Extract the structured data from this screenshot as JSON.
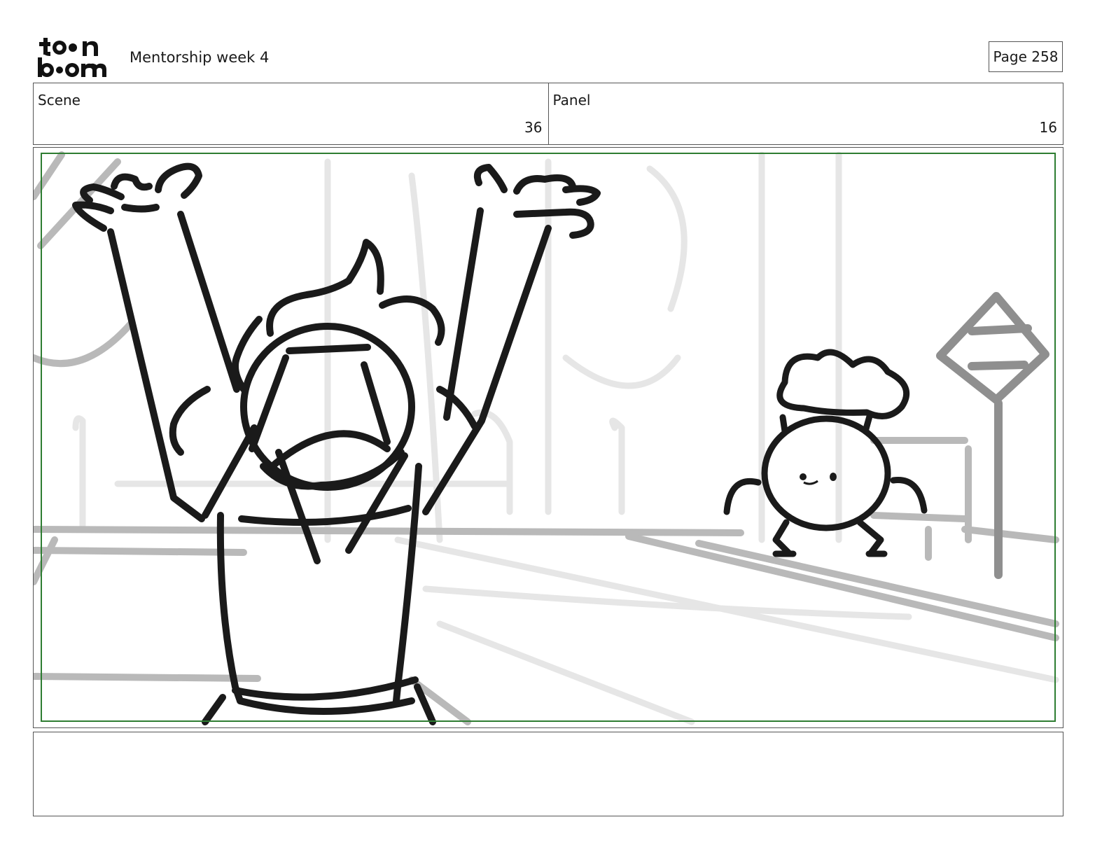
{
  "header": {
    "logo_alt": "toon boom",
    "title": "Mentorship week 4",
    "page_label": "Page 258"
  },
  "info": {
    "scene_label": "Scene",
    "scene_value": "36",
    "panel_label": "Panel",
    "panel_value": "16"
  },
  "panel": {
    "image_name": "storyboard-sketch"
  },
  "caption": {
    "text": ""
  },
  "colors": {
    "safe_frame": "#2e7d32",
    "ink": "#1a1a1a",
    "background_sketch": "#cfcfcf"
  }
}
